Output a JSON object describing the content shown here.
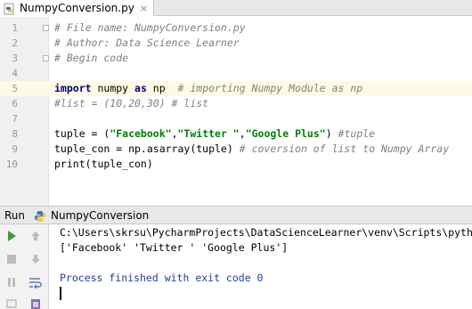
{
  "tab": {
    "file_name": "NumpyConversion.py",
    "close_glyph": "×"
  },
  "editor": {
    "current_line": 5,
    "line_numbers": [
      "1",
      "2",
      "3",
      "4",
      "5",
      "6",
      "7",
      "8",
      "9",
      "10"
    ],
    "lines": {
      "l1": {
        "comment": "# File name: NumpyConversion.py"
      },
      "l2": {
        "comment": "# Author: Data Science Learner"
      },
      "l3": {
        "comment": "# Begin code"
      },
      "l5": {
        "kw_import": "import",
        "module": " numpy ",
        "kw_as": "as",
        "alias": " np  ",
        "comment": "# importing Numpy Module as np"
      },
      "l6": {
        "comment": "#list = (10,20,30) # list"
      },
      "l8": {
        "prefix": "tuple = (",
        "s1": "\"Facebook\"",
        "c1": ",",
        "s2": "\"Twitter \"",
        "c2": ",",
        "s3": "\"Google Plus\"",
        "suffix": ") ",
        "comment": "#tuple"
      },
      "l9": {
        "code": "tuple_con = np.asarray(tuple) ",
        "comment": "# coversion of list to Numpy Array"
      },
      "l10": {
        "code": "print(tuple_con)"
      }
    }
  },
  "run_panel": {
    "title": "Run",
    "config_name": "NumpyConversion",
    "console": [
      "C:\\Users\\skrsu\\PycharmProjects\\DataScienceLearner\\venv\\Scripts\\pyth",
      "['Facebook' 'Twitter ' 'Google Plus']",
      "",
      "Process finished with exit code 0"
    ]
  },
  "colors": {
    "keyword": "#000080",
    "string": "#008000",
    "comment": "#808080",
    "current_line": "#fffae3",
    "run_green": "#3c9c3c",
    "exit_text": "#1f3fa0"
  }
}
